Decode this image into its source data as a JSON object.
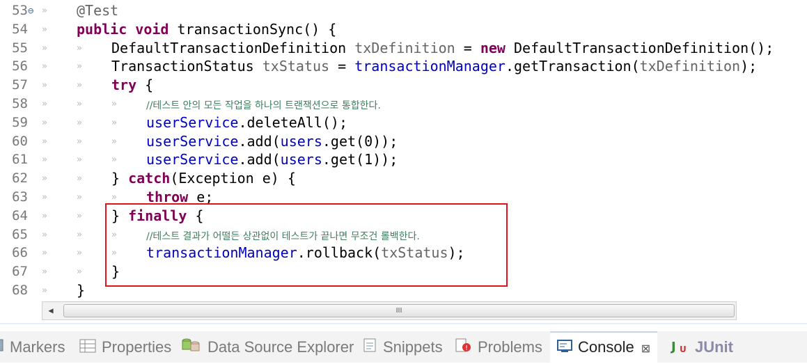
{
  "editor": {
    "lines": [
      {
        "num": "53",
        "fold": true,
        "indent": 1,
        "tokens": [
          {
            "t": "@Test",
            "c": "ann"
          }
        ]
      },
      {
        "num": "54",
        "indent": 1,
        "tokens": [
          {
            "t": "public",
            "c": "kw"
          },
          {
            "t": " "
          },
          {
            "t": "void",
            "c": "kw"
          },
          {
            "t": " transactionSync() {"
          }
        ]
      },
      {
        "num": "55",
        "indent": 2,
        "tokens": [
          {
            "t": "DefaultTransactionDefinition "
          },
          {
            "t": "txDefinition",
            "c": "ann"
          },
          {
            "t": " = "
          },
          {
            "t": "new",
            "c": "kw"
          },
          {
            "t": " DefaultTransactionDefinition();"
          }
        ]
      },
      {
        "num": "56",
        "indent": 2,
        "tokens": [
          {
            "t": "TransactionStatus "
          },
          {
            "t": "txStatus",
            "c": "ann"
          },
          {
            "t": " = "
          },
          {
            "t": "transactionManager",
            "c": "fld"
          },
          {
            "t": ".getTransaction("
          },
          {
            "t": "txDefinition",
            "c": "ann"
          },
          {
            "t": ");"
          }
        ]
      },
      {
        "num": "57",
        "indent": 2,
        "tokens": [
          {
            "t": "try",
            "c": "kw"
          },
          {
            "t": " {"
          }
        ]
      },
      {
        "num": "58",
        "indent": 3,
        "tokens": [
          {
            "t": "//테스트 안의 모든 작업을 하나의 트랜잭션으로 통합한다.",
            "c": "cmt"
          }
        ]
      },
      {
        "num": "59",
        "indent": 3,
        "tokens": [
          {
            "t": "userService",
            "c": "fld"
          },
          {
            "t": ".deleteAll();"
          }
        ]
      },
      {
        "num": "60",
        "indent": 3,
        "tokens": [
          {
            "t": "userService",
            "c": "fld"
          },
          {
            "t": ".add("
          },
          {
            "t": "users",
            "c": "fld"
          },
          {
            "t": ".get(0));"
          }
        ]
      },
      {
        "num": "61",
        "indent": 3,
        "tokens": [
          {
            "t": "userService",
            "c": "fld"
          },
          {
            "t": ".add("
          },
          {
            "t": "users",
            "c": "fld"
          },
          {
            "t": ".get(1));"
          }
        ]
      },
      {
        "num": "62",
        "indent": 2,
        "tokens": [
          {
            "t": "} "
          },
          {
            "t": "catch",
            "c": "kw"
          },
          {
            "t": "(Exception e) {"
          }
        ]
      },
      {
        "num": "63",
        "indent": 3,
        "tokens": [
          {
            "t": "throw",
            "c": "kw"
          },
          {
            "t": " e;"
          }
        ]
      },
      {
        "num": "64",
        "indent": 2,
        "tokens": [
          {
            "t": "} "
          },
          {
            "t": "finally",
            "c": "kw"
          },
          {
            "t": " {"
          }
        ]
      },
      {
        "num": "65",
        "indent": 3,
        "tokens": [
          {
            "t": "//테스트 결과가 어떨든 상관없이 테스트가 끝나면 무조건 롤백한다.",
            "c": "cmt"
          }
        ]
      },
      {
        "num": "66",
        "indent": 3,
        "tokens": [
          {
            "t": "transactionManager",
            "c": "fld"
          },
          {
            "t": ".rollback("
          },
          {
            "t": "txStatus",
            "c": "ann"
          },
          {
            "t": ");"
          }
        ]
      },
      {
        "num": "67",
        "indent": 2,
        "tokens": [
          {
            "t": "}"
          }
        ]
      },
      {
        "num": "68",
        "indent": 1,
        "tokens": [
          {
            "t": "}"
          }
        ]
      }
    ],
    "tab_marker": "»"
  },
  "scrollbar": {
    "left_arrow": "◀",
    "thumb_grip": "III"
  },
  "bottom_tabs": [
    {
      "label": "Markers",
      "icon": "markers-icon",
      "active": false
    },
    {
      "label": "Properties",
      "icon": "properties-icon",
      "active": false
    },
    {
      "label": "Data Source Explorer",
      "icon": "data-source-icon",
      "active": false
    },
    {
      "label": "Snippets",
      "icon": "snippets-icon",
      "active": false
    },
    {
      "label": "Problems",
      "icon": "problems-icon",
      "active": false
    },
    {
      "label": "Console",
      "icon": "console-icon",
      "active": true,
      "close": "⊠"
    },
    {
      "label": "JUnit",
      "icon": "junit-icon",
      "active": false
    }
  ]
}
